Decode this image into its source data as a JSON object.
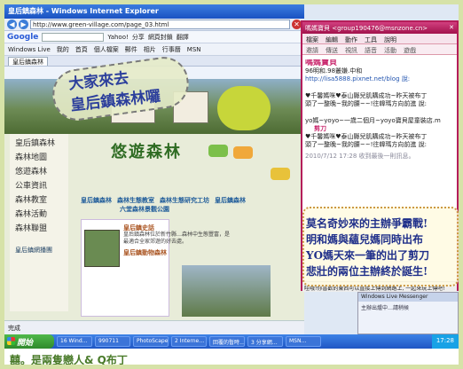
{
  "ie": {
    "title": "皇后鎮森林 - Windows Internet Explorer",
    "address": "http://www.green-village.com/page_03.html",
    "google_label": "Google",
    "toolbar_items": [
      "Yahoo!",
      "分享",
      "網頁封鎖",
      "翻譯"
    ],
    "links": [
      "Windows Live",
      "我的",
      "首頁",
      "個人檔案",
      "郵件",
      "相片",
      "行事曆",
      "MSN"
    ],
    "tabs": [
      "皇后鎮森林"
    ],
    "status": "完成",
    "page": {
      "title": "悠遊森林",
      "left_nav": [
        "皇后鎮森林",
        "森林地圖",
        "悠遊森林",
        "公車資訊",
        "森林教室",
        "森林活動",
        "森林聯盟"
      ],
      "menu_row1": [
        "皇后鎮森林",
        "森林生態教室",
        "森林生態研究工坊",
        "皇后鎮森林"
      ],
      "menu_row2": "六堂森林景觀公園",
      "info_heading": "皇后鎮史話",
      "info_text": "皇后鎮森林位於新竹縣…森林中生態豐富，是最適合全家郊遊的好去處。",
      "info_heading2": "皇后鎮動物森林",
      "side_link": "皇后鎮網播團"
    }
  },
  "msn": {
    "title": "嗎媽寶貝 <group190476@msnzone.cn>",
    "menu": [
      "檔案",
      "編輯",
      "動作",
      "工具",
      "說明"
    ],
    "toolbar": [
      "邀請",
      "傳送",
      "視訊",
      "語音",
      "活動",
      "遊戲"
    ],
    "lines": [
      {
        "text": "嗎媽寶貝",
        "style": "pink"
      },
      {
        "text": "96明和.98叢嫌.中和",
        "style": ""
      },
      {
        "text": "http://lisa5888.pixnet.net/blog 說:",
        "style": "blue"
      },
      {
        "text": "♥千馨媽咪♥泰山縣兒肌購成功~昨天被布丁",
        "style": ""
      },
      {
        "text": "頭了一整晚~我的腰~~!往韓瑪方向前進 說:",
        "style": ""
      },
      {
        "text": "yo媽~yoyo~一歲二個月~yoyo寶貝屋童裝店.m",
        "style": ""
      },
      {
        "text": "剪刀",
        "style": "pink"
      },
      {
        "text": "♥千馨媽咪♥泰山縣兒肌購成功~昨天被布丁",
        "style": ""
      },
      {
        "text": "頭了一整晚~我的腰~~!往韓瑪方向前進 說:",
        "style": ""
      },
      {
        "text": "2010/7/12 17:28 收到最後一則訊息。",
        "style": "blue"
      }
    ],
    "input_text": "哇哦!你喜歡的東西可以直接上傳到網路上, 一起來玩上傳吧!"
  },
  "overlay": {
    "topleft_line1": "大家來去",
    "topleft_line2": "皇后鎮森林囉",
    "right_lines": [
      "莫名奇妙來的主辦爭霸戰!",
      "明和媽與蘊兒媽同時出布",
      "YO媽天來一筆的出了剪刀",
      "悲壯的兩位主辦終於誕生!"
    ]
  },
  "popup": {
    "title": "Windows Live Messenger",
    "text": "主辦出爐中…請稍候"
  },
  "taskbar": {
    "start": "開始",
    "tasks": [
      "16 Wind…",
      "990711",
      "PhotoScape",
      "2 Interne…",
      "回覆的暫時…",
      "3 分享網…",
      "MSN…"
    ],
    "clock": "17:28"
  },
  "bottom_caption": "囍。是兩隻戀人& Q布丁"
}
